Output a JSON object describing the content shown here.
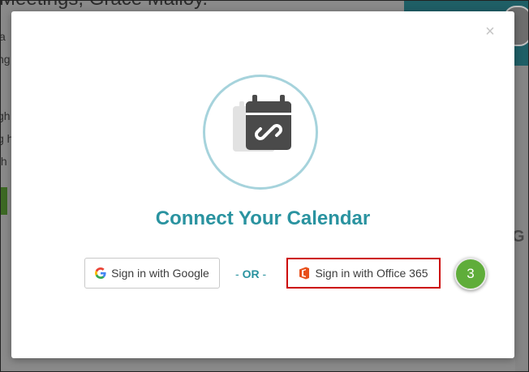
{
  "background": {
    "title": "Meetings, Grace Malloy.",
    "fragments": [
      "a",
      "ng",
      "gh",
      "g h",
      "th"
    ]
  },
  "modal": {
    "close_label": "×",
    "heading": "Connect Your Calendar",
    "google_button_label": "Sign in with Google",
    "or_prefix": "- ",
    "or_label": "OR",
    "or_suffix": " -",
    "office_button_label": "Sign in with Office 365",
    "step_number": "3"
  },
  "colors": {
    "accent_teal": "#2a93a0",
    "highlight_red": "#cc0000",
    "step_green": "#5fad3a",
    "office_orange": "#e8501b"
  }
}
